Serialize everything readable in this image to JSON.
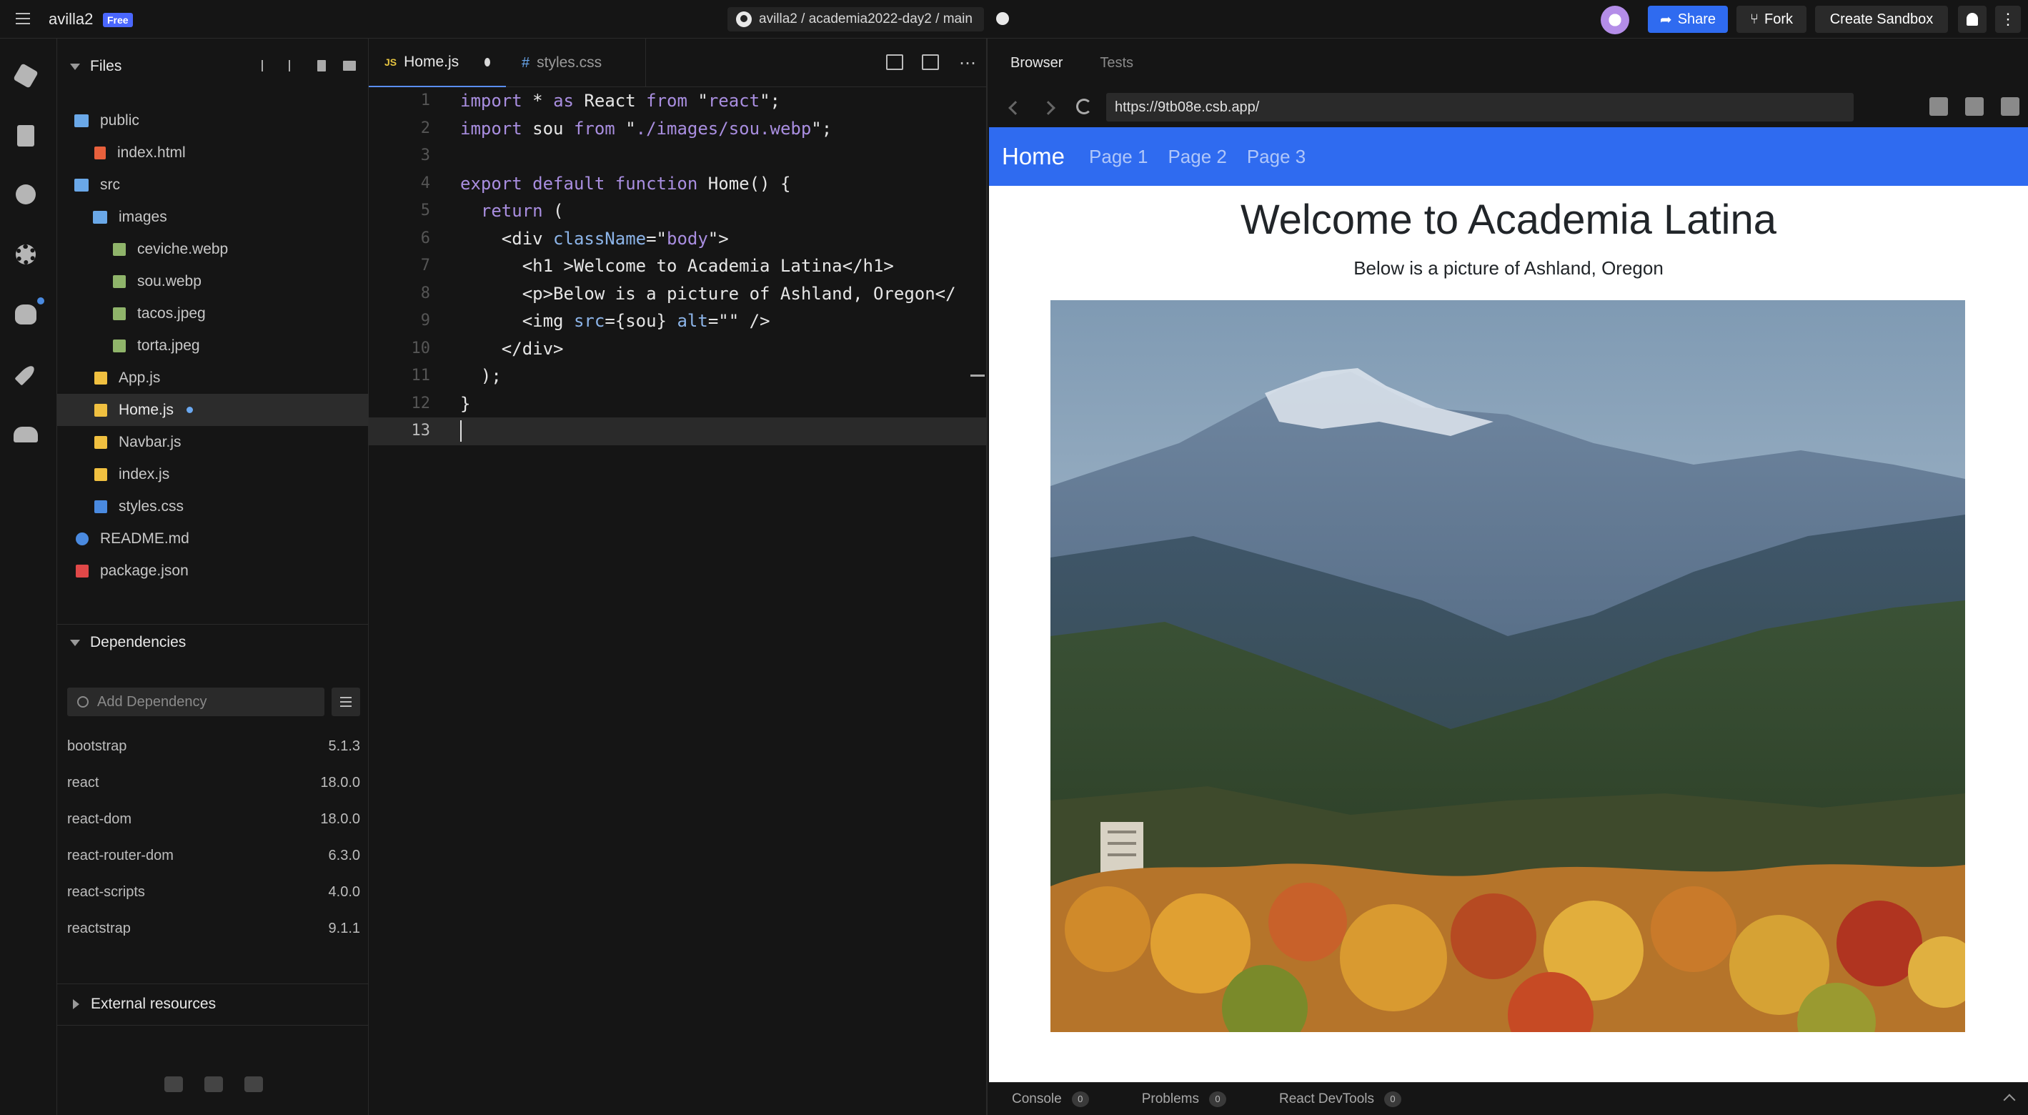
{
  "topbar": {
    "app_name": "avilla2",
    "plan_badge": "Free",
    "repo_path": "avilla2 / academia2022-day2 / main",
    "share_label": "Share",
    "fork_label": "Fork",
    "create_label": "Create Sandbox"
  },
  "sidebar": {
    "files_title": "Files",
    "tree": [
      {
        "name": "public",
        "icon": "folder-icon"
      },
      {
        "name": "index.html",
        "icon": "html-file-icon"
      },
      {
        "name": "src",
        "icon": "folder-icon"
      },
      {
        "name": "images",
        "icon": "folder-icon"
      },
      {
        "name": "ceviche.webp",
        "icon": "image-file-icon"
      },
      {
        "name": "sou.webp",
        "icon": "image-file-icon"
      },
      {
        "name": "tacos.jpeg",
        "icon": "image-file-icon"
      },
      {
        "name": "torta.jpeg",
        "icon": "image-file-icon"
      },
      {
        "name": "App.js",
        "icon": "js-file-icon"
      },
      {
        "name": "Home.js",
        "icon": "js-file-icon",
        "active": true,
        "modified": true
      },
      {
        "name": "Navbar.js",
        "icon": "js-file-icon"
      },
      {
        "name": "index.js",
        "icon": "js-file-icon"
      },
      {
        "name": "styles.css",
        "icon": "css-file-icon"
      },
      {
        "name": "README.md",
        "icon": "info-file-icon"
      },
      {
        "name": "package.json",
        "icon": "package-file-icon"
      }
    ],
    "dependencies_title": "Dependencies",
    "dependency_placeholder": "Add Dependency",
    "dependencies": [
      {
        "name": "bootstrap",
        "version": "5.1.3"
      },
      {
        "name": "react",
        "version": "18.0.0"
      },
      {
        "name": "react-dom",
        "version": "18.0.0"
      },
      {
        "name": "react-router-dom",
        "version": "6.3.0"
      },
      {
        "name": "react-scripts",
        "version": "4.0.0"
      },
      {
        "name": "reactstrap",
        "version": "9.1.1"
      }
    ],
    "external_title": "External resources"
  },
  "editor": {
    "tabs": [
      {
        "lang": "JS",
        "label": "Home.js",
        "dirty": true
      },
      {
        "lang": "#",
        "label": "styles.css"
      }
    ],
    "lines": [
      "import * as React from \"react\";",
      "import sou from \"./images/sou.webp\";",
      "",
      "export default function Home() {",
      "  return (",
      "    <div className=\"body\">",
      "      <h1 >Welcome to Academia Latina</h1>",
      "      <p>Below is a picture of Ashland, Oregon</",
      "      <img src={sou} alt=\"\" />",
      "    </div>",
      "  );",
      "}",
      ""
    ]
  },
  "browser": {
    "tabs": [
      "Browser",
      "Tests"
    ],
    "url": "https://9tb08e.csb.app/",
    "page": {
      "brand": "Home",
      "links": [
        "Page 1",
        "Page 2",
        "Page 3"
      ],
      "heading": "Welcome to Academia Latina",
      "paragraph": "Below is a picture of Ashland, Oregon"
    },
    "bottom_tabs": [
      {
        "label": "Console",
        "count": "0"
      },
      {
        "label": "Problems",
        "count": "0"
      },
      {
        "label": "React DevTools",
        "count": "0"
      }
    ]
  },
  "colors": {
    "accent": "#2f6bf0",
    "background": "#151515"
  }
}
